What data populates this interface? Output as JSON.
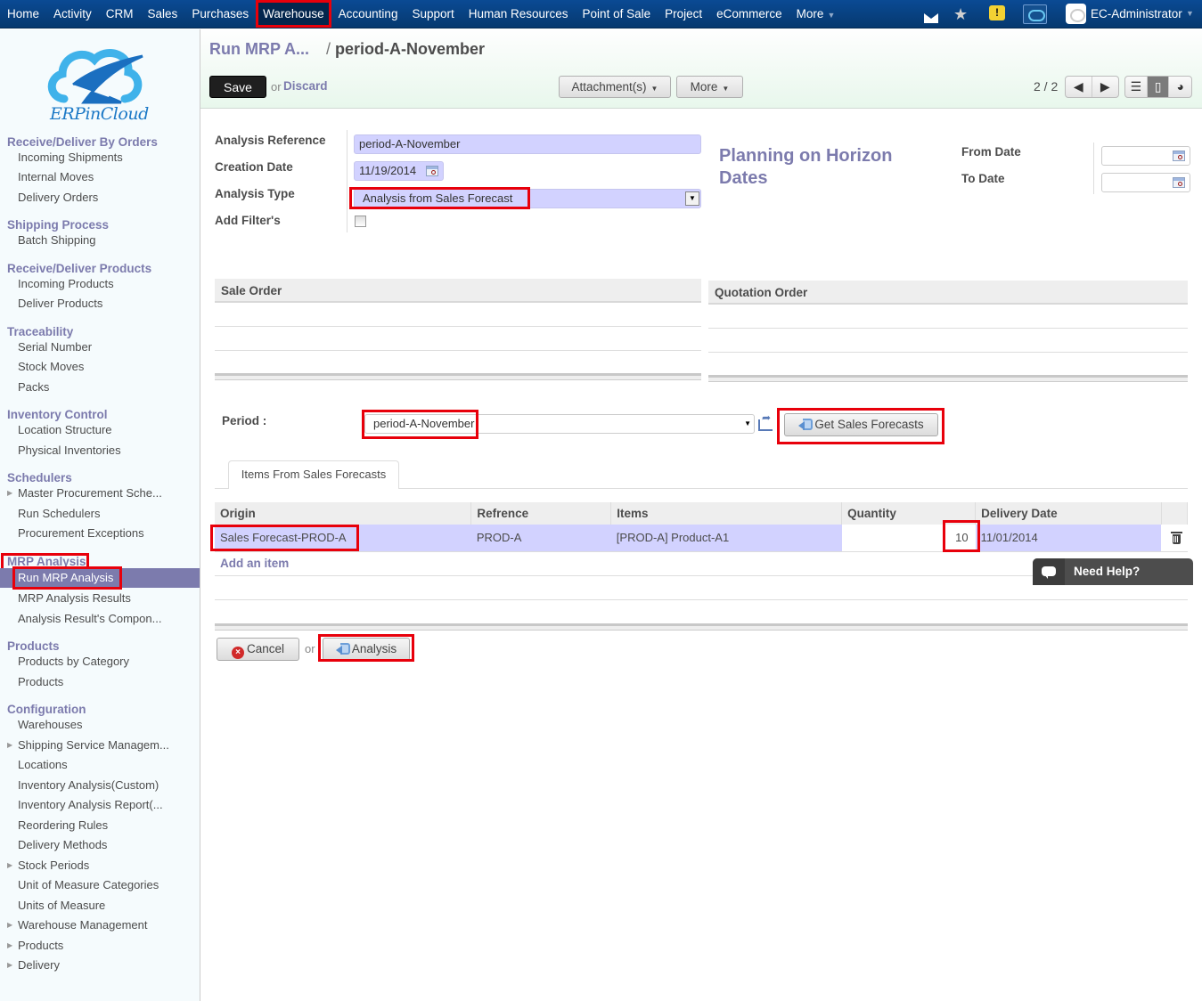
{
  "topnav": {
    "items": [
      "Home",
      "Activity",
      "CRM",
      "Sales",
      "Purchases",
      "Warehouse",
      "Accounting",
      "Support",
      "Human Resources",
      "Point of Sale",
      "Project",
      "eCommerce",
      "More"
    ],
    "active": "Warehouse",
    "user": "EC-Administrator",
    "icons": [
      "mail-icon",
      "star-icon",
      "warning-icon",
      "cloud-app-icon",
      "user-avatar"
    ]
  },
  "sidebar": {
    "logo_text": "ERPinCloud",
    "groups": [
      {
        "title": "Receive/Deliver By Orders",
        "items": [
          {
            "label": "Incoming Shipments"
          },
          {
            "label": "Internal Moves"
          },
          {
            "label": "Delivery Orders"
          }
        ]
      },
      {
        "title": "Shipping Process",
        "items": [
          {
            "label": "Batch Shipping"
          }
        ]
      },
      {
        "title": "Receive/Deliver Products",
        "items": [
          {
            "label": "Incoming Products"
          },
          {
            "label": "Deliver Products"
          }
        ]
      },
      {
        "title": "Traceability",
        "items": [
          {
            "label": "Serial Number"
          },
          {
            "label": "Stock Moves"
          },
          {
            "label": "Packs"
          }
        ]
      },
      {
        "title": "Inventory Control",
        "items": [
          {
            "label": "Location Structure"
          },
          {
            "label": "Physical Inventories"
          }
        ]
      },
      {
        "title": "Schedulers",
        "items": [
          {
            "label": "Master Procurement Sche...",
            "expandable": true
          },
          {
            "label": "Run Schedulers"
          },
          {
            "label": "Procurement Exceptions"
          }
        ]
      },
      {
        "title": "MRP Analysis",
        "items": [
          {
            "label": "Run MRP Analysis",
            "selected": true
          },
          {
            "label": "MRP Analysis Results"
          },
          {
            "label": "Analysis Result's Compon..."
          }
        ]
      },
      {
        "title": "Products",
        "items": [
          {
            "label": "Products by Category"
          },
          {
            "label": "Products"
          }
        ]
      },
      {
        "title": "Configuration",
        "items": [
          {
            "label": "Warehouses"
          },
          {
            "label": "Shipping Service Managem...",
            "expandable": true
          },
          {
            "label": "Locations"
          },
          {
            "label": "Inventory Analysis(Custom)"
          },
          {
            "label": "Inventory Analysis Report(..."
          },
          {
            "label": "Reordering Rules"
          },
          {
            "label": "Delivery Methods"
          },
          {
            "label": "Stock Periods",
            "expandable": true
          },
          {
            "label": "Unit of Measure Categories"
          },
          {
            "label": "Units of Measure"
          },
          {
            "label": "Warehouse Management",
            "expandable": true
          },
          {
            "label": "Products",
            "expandable": true
          },
          {
            "label": "Delivery",
            "expandable": true
          }
        ]
      }
    ]
  },
  "header": {
    "breadcrumb_parent": "Run MRP A...",
    "breadcrumb_sep": "/",
    "breadcrumb_current": "period-A-November",
    "save_label": "Save",
    "or_label": "or",
    "discard_label": "Discard",
    "attachments_label": "Attachment(s)",
    "more_label": "More",
    "pager": "2 / 2"
  },
  "form": {
    "analysis_reference_label": "Analysis Reference",
    "analysis_reference_value": "period-A-November",
    "creation_date_label": "Creation Date",
    "creation_date_value": "11/19/2014",
    "analysis_type_label": "Analysis Type",
    "analysis_type_value": "Analysis from Sales Forecast",
    "add_filters_label": "Add Filter's",
    "add_filters_checked": false,
    "horizon_title": "Planning on Horizon Dates",
    "from_date_label": "From Date",
    "from_date_value": "",
    "to_date_label": "To Date",
    "to_date_value": "",
    "sale_order_header": "Sale Order",
    "quotation_order_header": "Quotation Order",
    "period_label": "Period :",
    "period_value": "period-A-November",
    "get_forecasts_label": "Get Sales Forecasts",
    "tab_label": "Items From Sales Forecasts"
  },
  "items_table": {
    "columns": [
      "Origin",
      "Refrence",
      "Items",
      "Quantity",
      "Delivery Date"
    ],
    "rows": [
      {
        "origin": "Sales Forecast-PROD-A",
        "reference": "PROD-A",
        "items": "[PROD-A] Product-A1",
        "quantity": "10",
        "delivery_date": "11/01/2014"
      }
    ],
    "add_item_label": "Add an item"
  },
  "footer": {
    "cancel_label": "Cancel",
    "or_label": "or",
    "analysis_label": "Analysis"
  },
  "help": {
    "label": "Need Help?"
  }
}
